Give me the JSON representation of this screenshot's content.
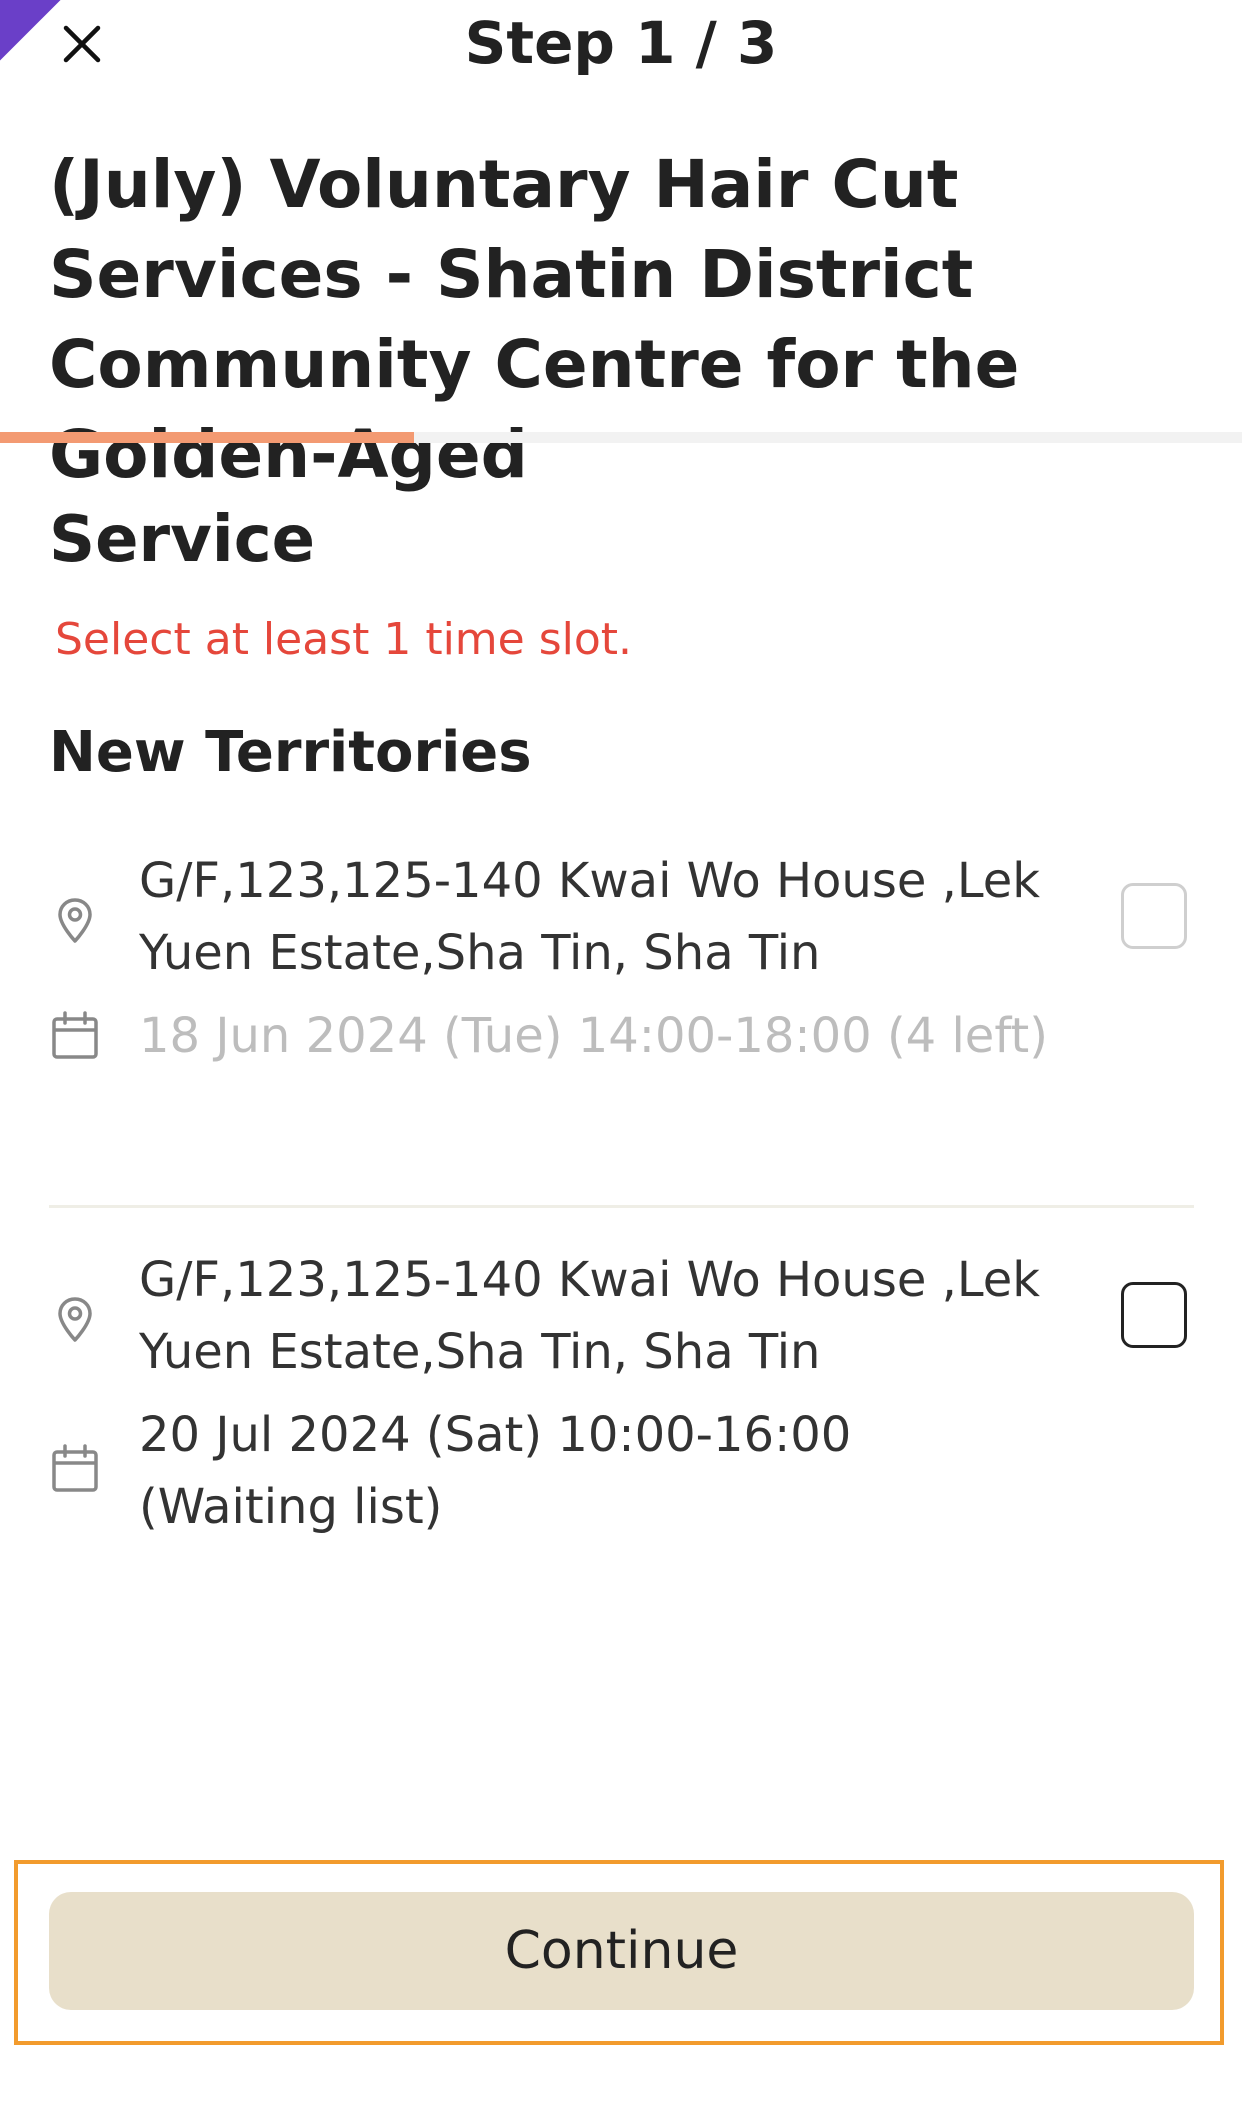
{
  "header": {
    "step_label": "Step 1 / 3",
    "title": "(July) Voluntary Hair Cut Services - Shatin District Community Centre for the Golden-Aged"
  },
  "progress": {
    "current_step": 1,
    "total_steps": 3,
    "fraction": 0.333,
    "fill_color": "#f39a72"
  },
  "service": {
    "section_title": "Service",
    "error_message": "Select at least 1 time slot.",
    "region_title": "New Territories",
    "slots": [
      {
        "address": "G/F,123,125-140 Kwai Wo House ,Lek Yuen Estate,Sha Tin, Sha Tin",
        "datetime": "18 Jun 2024 (Tue) 14:00-18:00 (4 left)",
        "available": false,
        "checked": false,
        "location_icon": "location-pin-icon",
        "calendar_icon": "calendar-icon"
      },
      {
        "address": "G/F,123,125-140 Kwai Wo House ,Lek Yuen Estate,Sha Tin, Sha Tin",
        "datetime": "20 Jul 2024 (Sat) 10:00-16:00 (Waiting list)",
        "available": true,
        "checked": false,
        "location_icon": "location-pin-icon",
        "calendar_icon": "calendar-icon"
      }
    ]
  },
  "footer": {
    "continue_label": "Continue",
    "button_color": "#e8dfca",
    "highlight_color": "#f29b2d"
  },
  "colors": {
    "error": "#e5473b",
    "muted_text": "#bdbdbd",
    "ribbon": "#6a3fc8"
  },
  "icons": {
    "close": "close-icon"
  }
}
